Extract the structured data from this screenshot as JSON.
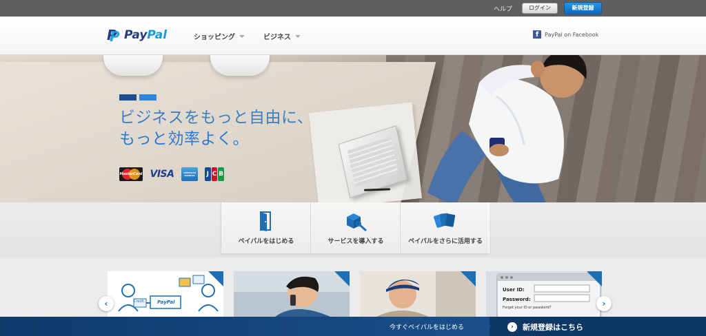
{
  "topbar": {
    "help": "ヘルプ",
    "login": "ログイン",
    "signup": "新規登録"
  },
  "header": {
    "logo_pay": "Pay",
    "logo_pal": "Pal",
    "nav": [
      "ショッピング",
      "ビジネス"
    ],
    "facebook": "PayPal on Facebook"
  },
  "hero": {
    "headline_line1": "ビジネスをもっと自由に、",
    "headline_line2": "もっと効率よく。",
    "stripe_colors": [
      "#1d4f91",
      "#2f86d6"
    ],
    "cards": {
      "mastercard": "MasterCard",
      "visa": "VISA",
      "amex": "AMERICAN EXPRESS",
      "jcb": [
        "J",
        "C",
        "B"
      ]
    }
  },
  "tabs": [
    {
      "label": "ペイパルをはじめる",
      "icon": "door-icon"
    },
    {
      "label": "サービスを導入する",
      "icon": "box-wrench-icon"
    },
    {
      "label": "ペイパルをさらに活用する",
      "icon": "cards-icon"
    }
  ],
  "slides": {
    "slide1": {
      "credit": "Credit",
      "paypal": "PayPal"
    },
    "slide4": {
      "user_id": "User ID:",
      "password": "Password:",
      "forgot": "Forgot your ID or password?"
    }
  },
  "cta": {
    "left_text": "今すぐペイパルをはじめる",
    "button_text": "新規登録はこちら"
  },
  "colors": {
    "brand_blue": "#1f6fb7",
    "dark_navy": "#0e3764"
  }
}
